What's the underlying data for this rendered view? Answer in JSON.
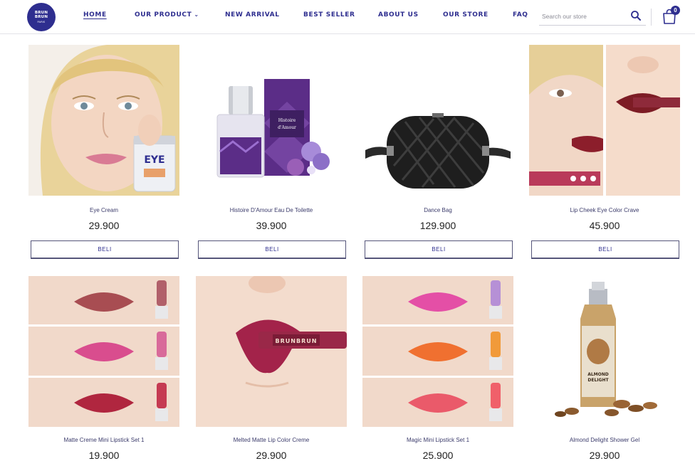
{
  "brand": {
    "logo_line1": "BRUN",
    "logo_line2": "BRUN",
    "logo_sub": "PARIS"
  },
  "nav": {
    "items": [
      {
        "label": "HOME",
        "active": true
      },
      {
        "label": "OUR PRODUCT",
        "active": false,
        "has_dropdown": true
      },
      {
        "label": "NEW ARRIVAL",
        "active": false
      },
      {
        "label": "BEST SELLER",
        "active": false
      },
      {
        "label": "ABOUT US",
        "active": false
      },
      {
        "label": "OUR STORE",
        "active": false
      },
      {
        "label": "FAQ",
        "active": false
      }
    ]
  },
  "search": {
    "placeholder": "Search our store",
    "icon": "search-icon"
  },
  "cart": {
    "count": "0",
    "icon": "shopping-bag-icon"
  },
  "products": [
    {
      "name": "Eye Cream",
      "price": "29.900",
      "buy_label": "BELI",
      "image": "woman-applying-eye-cream"
    },
    {
      "name": "Histoire D'Amour Eau De Toilette",
      "price": "39.900",
      "buy_label": "BELI",
      "image": "perfume-bottle-with-box"
    },
    {
      "name": "Dance Bag",
      "price": "129.900",
      "buy_label": "BELI",
      "image": "black-quilted-belt-bag"
    },
    {
      "name": "Lip Cheek Eye Color Crave",
      "price": "45.900",
      "buy_label": "BELI",
      "image": "model-with-red-lips"
    },
    {
      "name": "Matte Creme Mini Lipstick Set 1",
      "price": "19.900",
      "image": "three-lip-swatches"
    },
    {
      "name": "Melted Matte Lip Color Creme",
      "price": "29.900",
      "image": "lips-with-applicator"
    },
    {
      "name": "Magic Mini Lipstick Set 1",
      "price": "25.900",
      "image": "three-glossy-lip-swatches"
    },
    {
      "name": "Almond Delight Shower Gel",
      "price": "29.900",
      "image": "shower-gel-with-almonds"
    }
  ],
  "colors": {
    "brand": "#2e2e8f",
    "button_border": "#55557a",
    "skin": "#f2d8c9",
    "lip_red": "#b0263f",
    "lip_pink": "#d94d8e",
    "lip_rose": "#a84d52",
    "purple_box": "#5b2d87"
  }
}
